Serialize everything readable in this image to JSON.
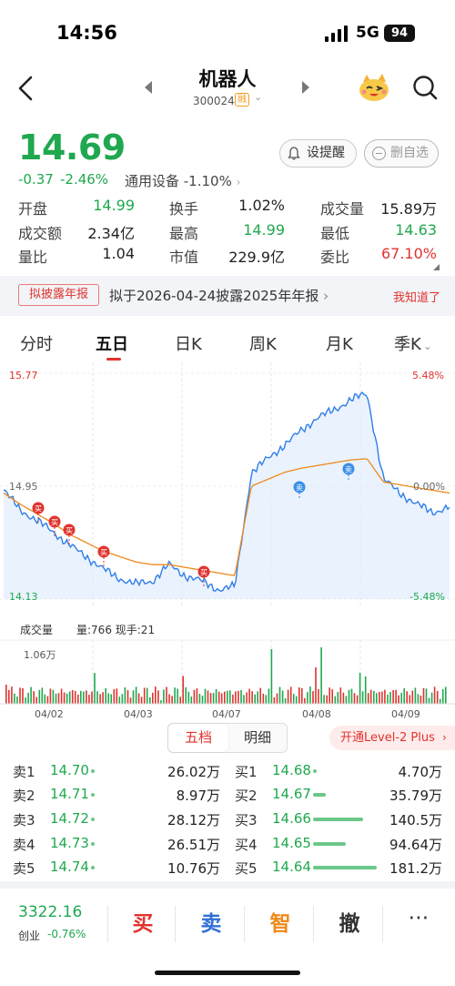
{
  "status": {
    "time": "14:56",
    "network": "5G",
    "battery": "94"
  },
  "header": {
    "title": "机器人",
    "code": "300024",
    "badge": "融"
  },
  "quote": {
    "price": "14.69",
    "change": "-0.37",
    "change_pct": "-2.46%",
    "industry": "通用设备 -1.10%",
    "alert_label": "设提醒",
    "watch_label": "删自选"
  },
  "stats": [
    [
      {
        "label": "开盘",
        "value": "14.99",
        "color": "green"
      },
      {
        "label": "换手",
        "value": "1.02%",
        "color": "black"
      },
      {
        "label": "成交量",
        "value": "15.89万",
        "color": "black"
      }
    ],
    [
      {
        "label": "成交额",
        "value": "2.34亿",
        "color": "black"
      },
      {
        "label": "最高",
        "value": "14.99",
        "color": "green"
      },
      {
        "label": "最低",
        "value": "14.63",
        "color": "green"
      }
    ],
    [
      {
        "label": "量比",
        "value": "1.04",
        "color": "black"
      },
      {
        "label": "市值",
        "value": "229.9亿",
        "color": "black"
      },
      {
        "label": "委比",
        "value": "67.10%",
        "color": "red"
      }
    ]
  ],
  "notice": {
    "tag": "拟披露年报",
    "text": "拟于2026-04-24披露2025年年报",
    "ack": "我知道了"
  },
  "tabs": [
    "分时",
    "五日",
    "日K",
    "周K",
    "月K",
    "季K"
  ],
  "active_tab": "五日",
  "chart": {
    "y_top": "15.77",
    "y_mid": "14.95",
    "y_bot": "14.13",
    "pct_top": "5.48%",
    "pct_mid": "0.00%",
    "pct_bot": "-5.48%",
    "buy_marker": "买",
    "sell_marker": "卖",
    "vol_header": "成交量",
    "vol_info": "量:766 现手:21",
    "vol_max": "1.06万",
    "dates": [
      "04/02",
      "04/03",
      "04/07",
      "04/08",
      "04/09"
    ]
  },
  "chart_data": {
    "type": "line",
    "title": "",
    "xlabel": "",
    "ylabel": "",
    "ylim": [
      14.13,
      15.77
    ],
    "x": [
      "04/02",
      "04/03",
      "04/07",
      "04/08",
      "04/09"
    ],
    "series": [
      {
        "values": [
          14.92,
          14.78,
          14.7,
          14.62,
          14.52,
          14.44,
          14.35,
          14.28,
          14.24,
          14.26,
          14.38,
          14.3,
          14.26,
          14.2,
          14.22,
          15.05,
          15.15,
          15.25,
          15.35,
          15.45,
          15.5,
          15.58,
          15.62,
          15.0,
          14.9,
          14.82,
          14.76,
          14.8
        ]
      },
      {
        "values": [
          14.9,
          14.82,
          14.75,
          14.68,
          14.6,
          14.54,
          14.48,
          14.44,
          14.4,
          14.38,
          14.38,
          14.36,
          14.34,
          14.32,
          14.3,
          14.95,
          15.0,
          15.05,
          15.08,
          15.1,
          15.12,
          15.14,
          15.15,
          14.98,
          14.96,
          14.94,
          14.92,
          14.9
        ]
      }
    ],
    "volume_max": 10600,
    "prev_close": 14.95
  },
  "orderbook": {
    "tabs": [
      "五档",
      "明细"
    ],
    "level2": "开通Level-2 Plus",
    "asks": [
      {
        "label": "卖1",
        "price": "14.70",
        "vol": "26.02万",
        "bar": 0.06
      },
      {
        "label": "卖2",
        "price": "14.71",
        "vol": "8.97万",
        "bar": 0.03
      },
      {
        "label": "卖3",
        "price": "14.72",
        "vol": "28.12万",
        "bar": 0.07
      },
      {
        "label": "卖4",
        "price": "14.73",
        "vol": "26.51万",
        "bar": 0.06
      },
      {
        "label": "卖5",
        "price": "14.74",
        "vol": "10.76万",
        "bar": 0.03
      }
    ],
    "bids": [
      {
        "label": "买1",
        "price": "14.68",
        "vol": "4.70万",
        "bar": 0.02
      },
      {
        "label": "买2",
        "price": "14.67",
        "vol": "35.79万",
        "bar": 0.2
      },
      {
        "label": "买3",
        "price": "14.66",
        "vol": "140.5万",
        "bar": 0.78
      },
      {
        "label": "买4",
        "price": "14.65",
        "vol": "94.64万",
        "bar": 0.52
      },
      {
        "label": "买5",
        "price": "14.64",
        "vol": "181.2万",
        "bar": 1.0
      }
    ]
  },
  "bottom": {
    "index_value": "3322.16",
    "index_name": "创业",
    "index_pct": "-0.76%",
    "actions": [
      {
        "label": "买",
        "color": "#e0332e"
      },
      {
        "label": "卖",
        "color": "#2f6fd6"
      },
      {
        "label": "智",
        "color": "#f08a1c"
      },
      {
        "label": "撤",
        "color": "#333333"
      }
    ],
    "more": "⋯"
  }
}
